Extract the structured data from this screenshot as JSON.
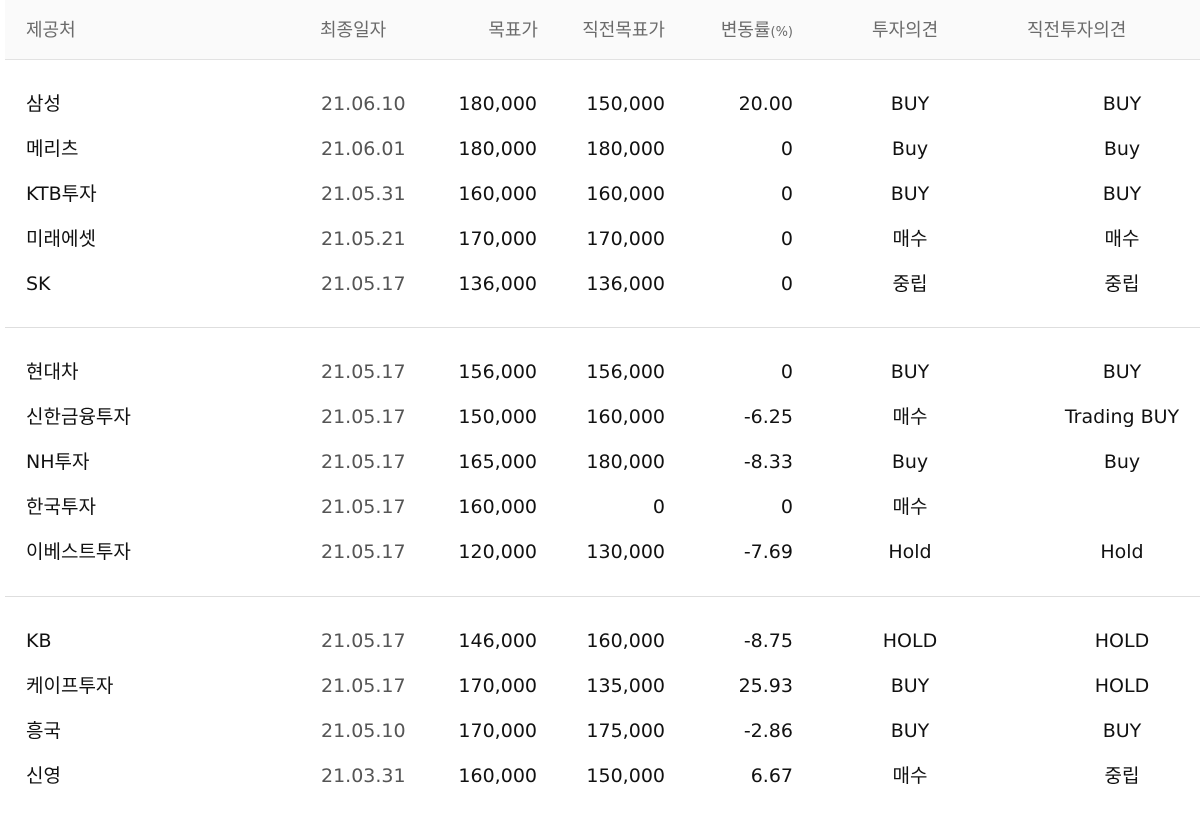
{
  "header": {
    "provider": "제공처",
    "date": "최종일자",
    "target": "목표가",
    "prev_target": "직전목표가",
    "change": "변동률",
    "change_unit": "(%)",
    "opinion": "투자의견",
    "prev_opinion": "직전투자의견"
  },
  "groups": [
    {
      "rows": [
        {
          "provider": "삼성",
          "date": "21.06.10",
          "target": "180,000",
          "prev_target": "150,000",
          "change": "20.00",
          "opinion": "BUY",
          "prev_opinion": "BUY"
        },
        {
          "provider": "메리츠",
          "date": "21.06.01",
          "target": "180,000",
          "prev_target": "180,000",
          "change": "0",
          "opinion": "Buy",
          "prev_opinion": "Buy"
        },
        {
          "provider": "KTB투자",
          "date": "21.05.31",
          "target": "160,000",
          "prev_target": "160,000",
          "change": "0",
          "opinion": "BUY",
          "prev_opinion": "BUY"
        },
        {
          "provider": "미래에셋",
          "date": "21.05.21",
          "target": "170,000",
          "prev_target": "170,000",
          "change": "0",
          "opinion": "매수",
          "prev_opinion": "매수"
        },
        {
          "provider": "SK",
          "date": "21.05.17",
          "target": "136,000",
          "prev_target": "136,000",
          "change": "0",
          "opinion": "중립",
          "prev_opinion": "중립"
        }
      ]
    },
    {
      "rows": [
        {
          "provider": "현대차",
          "date": "21.05.17",
          "target": "156,000",
          "prev_target": "156,000",
          "change": "0",
          "opinion": "BUY",
          "prev_opinion": "BUY"
        },
        {
          "provider": "신한금융투자",
          "date": "21.05.17",
          "target": "150,000",
          "prev_target": "160,000",
          "change": "-6.25",
          "opinion": "매수",
          "prev_opinion": "Trading BUY"
        },
        {
          "provider": "NH투자",
          "date": "21.05.17",
          "target": "165,000",
          "prev_target": "180,000",
          "change": "-8.33",
          "opinion": "Buy",
          "prev_opinion": "Buy"
        },
        {
          "provider": "한국투자",
          "date": "21.05.17",
          "target": "160,000",
          "prev_target": "0",
          "change": "0",
          "opinion": "매수",
          "prev_opinion": ""
        },
        {
          "provider": "이베스트투자",
          "date": "21.05.17",
          "target": "120,000",
          "prev_target": "130,000",
          "change": "-7.69",
          "opinion": "Hold",
          "prev_opinion": "Hold"
        }
      ]
    },
    {
      "rows": [
        {
          "provider": "KB",
          "date": "21.05.17",
          "target": "146,000",
          "prev_target": "160,000",
          "change": "-8.75",
          "opinion": "HOLD",
          "prev_opinion": "HOLD"
        },
        {
          "provider": "케이프투자",
          "date": "21.05.17",
          "target": "170,000",
          "prev_target": "135,000",
          "change": "25.93",
          "opinion": "BUY",
          "prev_opinion": "HOLD"
        },
        {
          "provider": "흥국",
          "date": "21.05.10",
          "target": "170,000",
          "prev_target": "175,000",
          "change": "-2.86",
          "opinion": "BUY",
          "prev_opinion": "BUY"
        },
        {
          "provider": "신영",
          "date": "21.03.31",
          "target": "160,000",
          "prev_target": "150,000",
          "change": "6.67",
          "opinion": "매수",
          "prev_opinion": "중립"
        }
      ]
    }
  ]
}
